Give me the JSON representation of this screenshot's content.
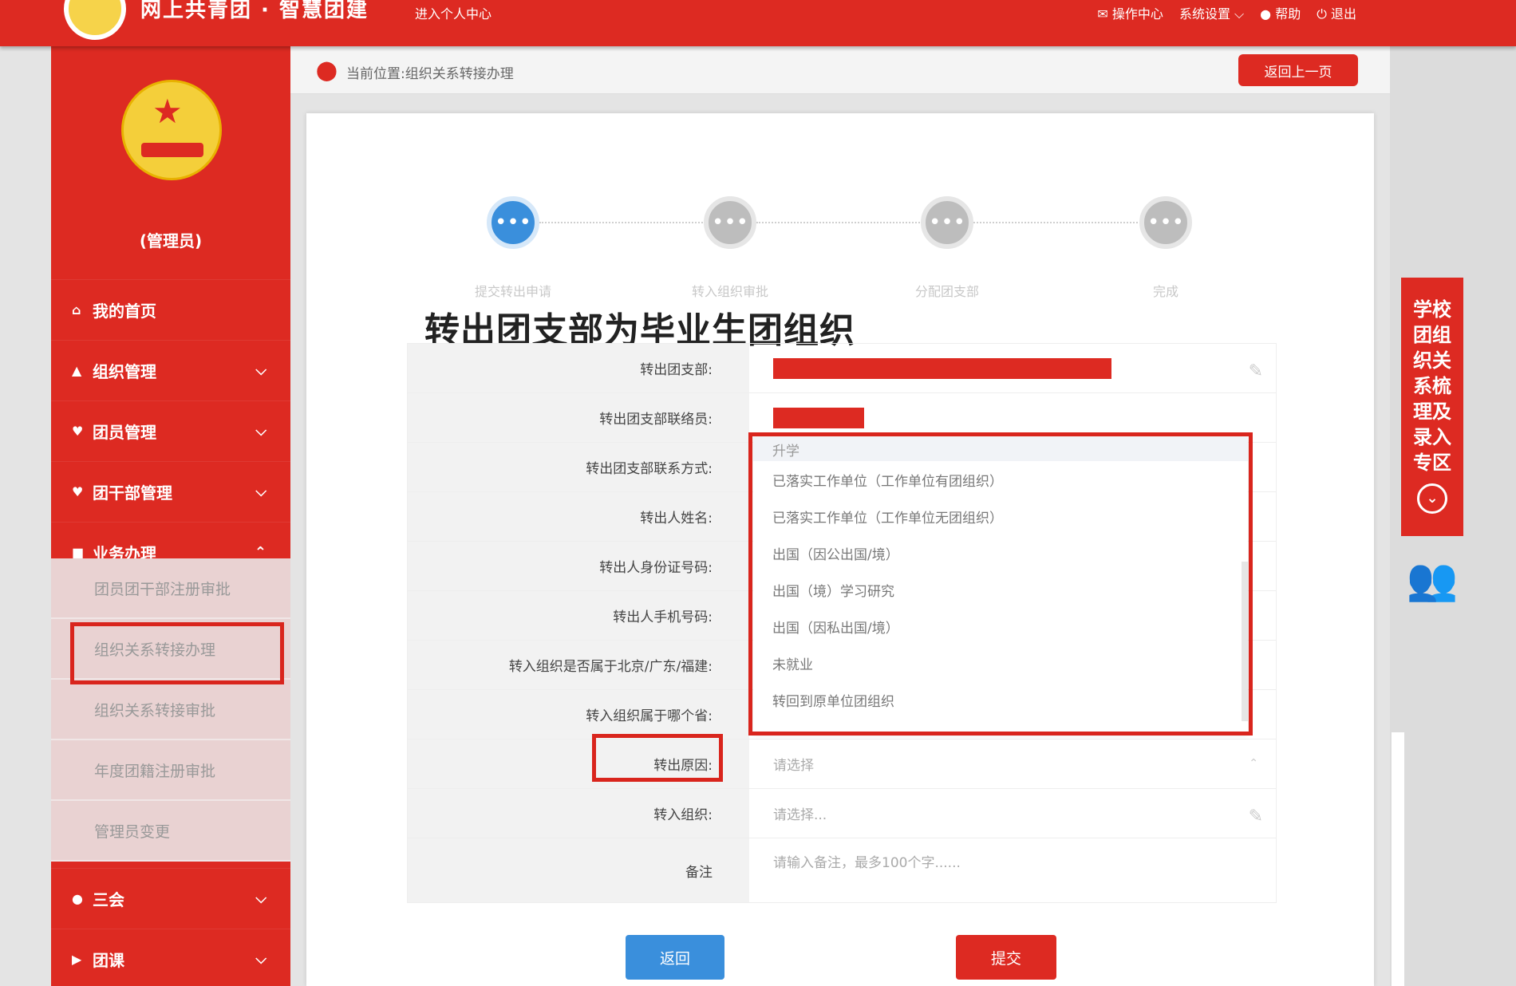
{
  "topbar": {
    "brand": "网上共青团 · 智慧团建",
    "sub": "进入个人中心",
    "menu": [
      "操作中心",
      "系统设置",
      "帮助",
      "退出"
    ]
  },
  "sidebar": {
    "username": "(管理员)",
    "nav": [
      {
        "label": "我的首页",
        "icon": "home-icon"
      },
      {
        "label": "组织管理",
        "icon": "org-icon"
      },
      {
        "label": "团员管理",
        "icon": "member-icon"
      },
      {
        "label": "团干部管理",
        "icon": "cadre-icon"
      },
      {
        "label": "业务办理",
        "icon": "business-icon"
      }
    ],
    "sub_items": [
      "团员团干部注册审批",
      "组织关系转接办理",
      "组织关系转接审批",
      "年度团籍注册审批",
      "管理员变更"
    ],
    "bottom_nav": [
      {
        "label": "三会",
        "icon": "meeting-icon"
      },
      {
        "label": "团课",
        "icon": "course-icon"
      }
    ]
  },
  "breadcrumb": {
    "text": "当前位置:组织关系转接办理",
    "back": "返回上一页"
  },
  "steps": [
    {
      "label": "提交转出申请",
      "glyph": "•••"
    },
    {
      "label": "转入组织审批",
      "glyph": "•••"
    },
    {
      "label": "分配团支部",
      "glyph": "•••"
    },
    {
      "label": "完成",
      "glyph": "•••"
    }
  ],
  "form": {
    "title": "转出团支部为毕业生团组织",
    "rows": [
      {
        "label": "转出团支部:",
        "required": true
      },
      {
        "label": "转出团支部联络员:",
        "required": false
      },
      {
        "label": "转出团支部联系方式:",
        "required": false
      },
      {
        "label": "转出人姓名:",
        "required": true
      },
      {
        "label": "转出人身份证号码:",
        "required": false
      },
      {
        "label": "转出人手机号码:",
        "required": false
      },
      {
        "label": "转入组织是否属于北京/广东/福建:",
        "required": true
      },
      {
        "label": "转入组织属于哪个省:",
        "required": true
      },
      {
        "label": "转出原因:",
        "required": true,
        "value": "请选择"
      },
      {
        "label": "转入组织:",
        "required": true,
        "value": "请选择..."
      },
      {
        "label": "备注",
        "required": false,
        "value": "请输入备注，最多100个字......"
      }
    ],
    "required_mark": "*"
  },
  "dropdown": {
    "options": [
      "升学",
      "已落实工作单位（工作单位有团组织）",
      "已落实工作单位（工作单位无团组织）",
      "出国（因公出国/境）",
      "出国（境）学习研究",
      "出国（因私出国/境）",
      "未就业",
      "转回到原单位团组织"
    ]
  },
  "buttons": {
    "back": "返回",
    "submit": "提交"
  },
  "sidetab": {
    "text": "学校团组织关系梳理及录入专区",
    "circle": "⌄",
    "icon": "👥"
  },
  "colors": {
    "brand_red": "#dd2a22",
    "accent_blue": "#3a8fdc"
  }
}
